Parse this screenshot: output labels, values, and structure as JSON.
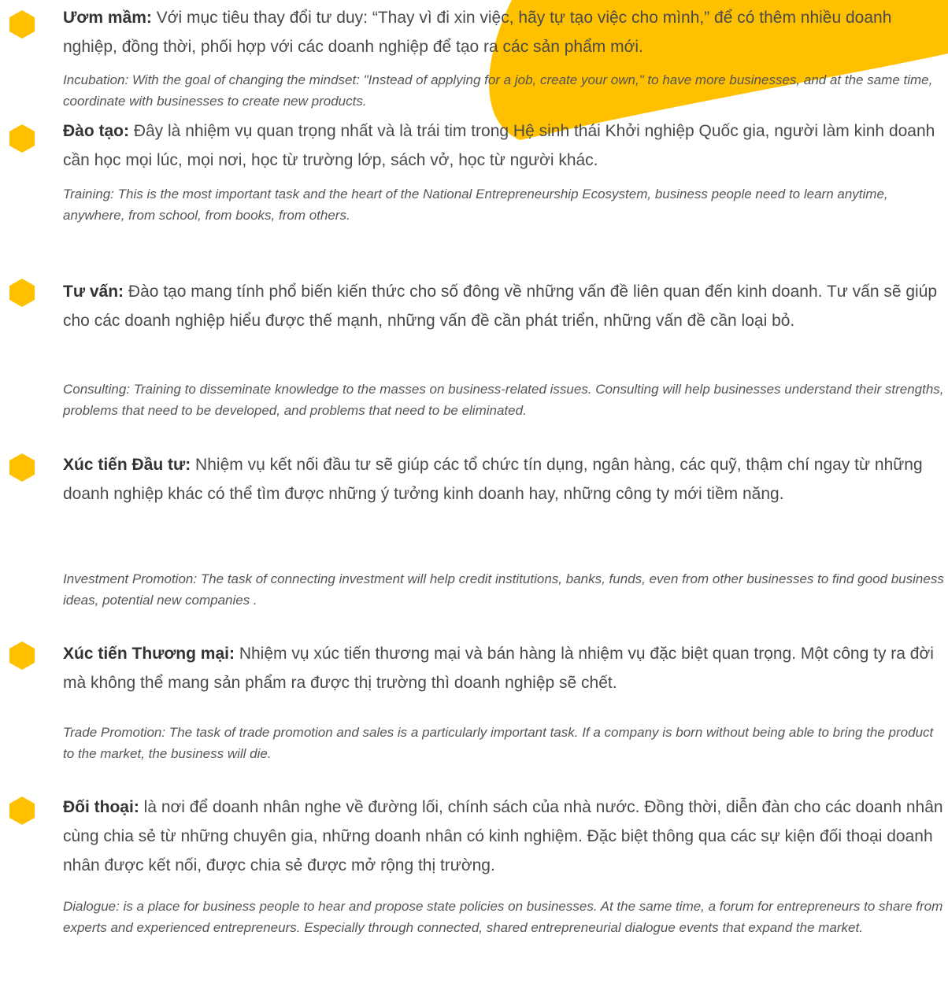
{
  "colors": {
    "accent": "#FFC000",
    "text": "#4a4a4a",
    "heading": "#333333",
    "translation": "#555555"
  },
  "items": [
    {
      "icon": "hexagon-bullet-icon",
      "title": "Ươm mầm:",
      "text": " Với mục tiêu thay đổi tư duy: “Thay vì đi xin việc, hãy tự tạo việc cho mình,”  để có thêm nhiều doanh nghiệp, đồng thời, phối hợp với các doanh nghiệp để tạo ra các sản phẩm mới.",
      "translation": "Incubation: With the goal of changing the mindset: \"Instead of applying for a job, create your own,\" to have more businesses, and at the same time, coordinate with businesses to create new products."
    },
    {
      "icon": "hexagon-bullet-icon",
      "title": "Đào tạo:",
      "text": " Đây là nhiệm vụ quan trọng nhất và là trái tim trong Hệ sinh thái Khởi nghiệp Quốc gia, người làm kinh doanh cần học mọi lúc, mọi nơi, học từ trường lớp, sách vở, học từ người khác.",
      "translation": "Training: This is the most important task and the heart of the National Entrepreneurship Ecosystem, business people need to learn anytime, anywhere, from school, from books, from others."
    },
    {
      "icon": "hexagon-bullet-icon",
      "title": "Tư vấn:",
      "text": " Đào tạo mang tính phổ biến kiến thức cho số đông về những vấn đề liên quan đến kinh doanh. Tư vấn sẽ giúp cho các doanh nghiệp hiểu được thế mạnh, những vấn đề cần phát triển, những vấn đề cần loại bỏ.",
      "translation": "Consulting: Training to disseminate knowledge to the masses on business-related issues. Consulting will help businesses understand their strengths, problems that need to be developed, and problems that need to be eliminated."
    },
    {
      "icon": "hexagon-bullet-icon",
      "title": "Xúc tiến Đầu tư:",
      "text": " Nhiệm vụ kết nối đầu tư sẽ giúp các tổ chức tín dụng, ngân hàng, các quỹ, thậm chí ngay từ những doanh nghiệp khác có thể tìm được những ý tưởng kinh doanh hay, những công ty mới tiềm năng.",
      "translation": "Investment Promotion: The task of connecting investment will help credit institutions, banks, funds, even from other businesses to find good business ideas, potential new companies ."
    },
    {
      "icon": "hexagon-bullet-icon",
      "title": "Xúc tiến Thương mại:",
      "text": " Nhiệm vụ xúc tiến thương mại và bán hàng là nhiệm vụ đặc biệt quan trọng. Một công ty ra đời mà không thể mang sản phẩm ra được thị trường thì doanh nghiệp sẽ chết.",
      "translation": "Trade Promotion: The task of trade promotion and sales is a particularly important task. If a company is born without being able to bring the product to the market, the business will die."
    },
    {
      "icon": "hexagon-bullet-icon",
      "title": "Đối thoại:",
      "text": " là nơi để doanh nhân nghe về đường lối, chính sách của nhà nước. Đồng thời, diễn đàn cho các doanh nhân cùng chia sẻ từ những chuyên gia, những doanh nhân có kinh nghiệm. Đặc biệt thông qua các sự kiện đối thoại doanh nhân được kết nối, được chia sẻ được mở rộng thị trường.",
      "translation": "Dialogue: is a place for business people to hear and propose state policies on businesses. At the same time, a forum for entrepreneurs to share from experts and experienced entrepreneurs. Especially through connected, shared entrepreneurial dialogue events that expand the market."
    }
  ]
}
